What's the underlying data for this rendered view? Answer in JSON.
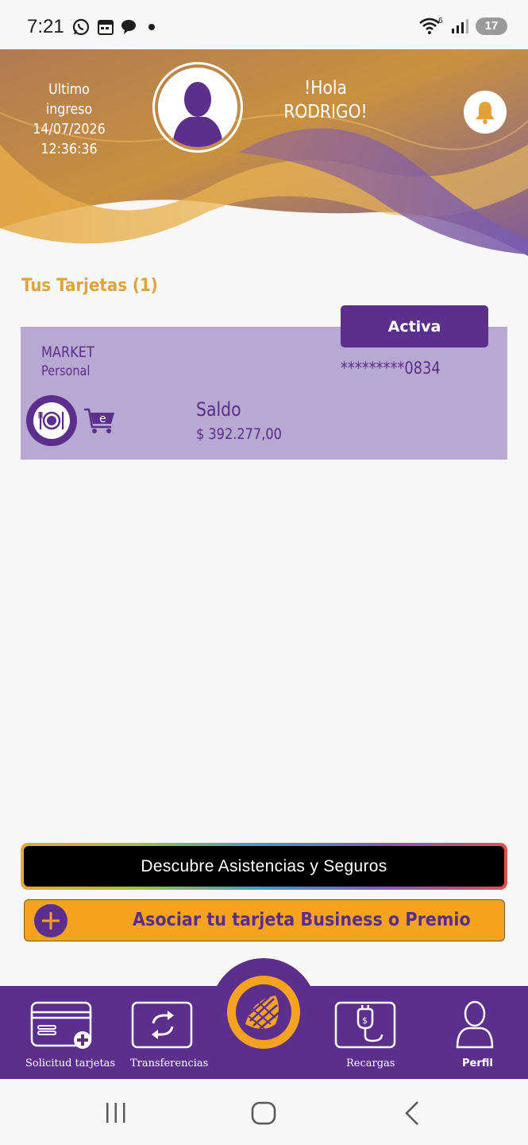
{
  "status_bar": {
    "time": "7:21",
    "battery": "17",
    "wifi_badge": "6"
  },
  "header": {
    "last_login_label": "Ultimo ingreso",
    "last_login_date": "14/07/2026",
    "last_login_time": "12:36:36",
    "greeting_line1": "!Hola",
    "greeting_line2": "RODRIGO!"
  },
  "cards_section": {
    "title": "Tus Tarjetas (1)",
    "cards": [
      {
        "status": "Activa",
        "name": "MARKET",
        "type": "Personal",
        "number": "*********0834",
        "balance_label": "Saldo",
        "balance_value": "$ 392.277,00",
        "cart_badge": "e"
      }
    ]
  },
  "actions": {
    "discover_label": "Descubre Asistencias y Seguros",
    "associate_label": "Asociar tu tarjeta Business o Premio"
  },
  "bottom_nav": {
    "items": [
      {
        "label": "Solicitud tarjetas",
        "icon": "card-add-icon"
      },
      {
        "label": "Transferencias",
        "icon": "transfer-icon"
      },
      {
        "label": "",
        "icon": "brand-logo-icon"
      },
      {
        "label": "Recargas",
        "icon": "plug-recharge-icon"
      },
      {
        "label": "Perfil",
        "icon": "user-icon"
      }
    ]
  },
  "colors": {
    "brand_purple": "#5c2f8c",
    "brand_orange": "#f5a31f",
    "card_background": "#b8a9d2",
    "title_gold": "#e0a33a"
  }
}
